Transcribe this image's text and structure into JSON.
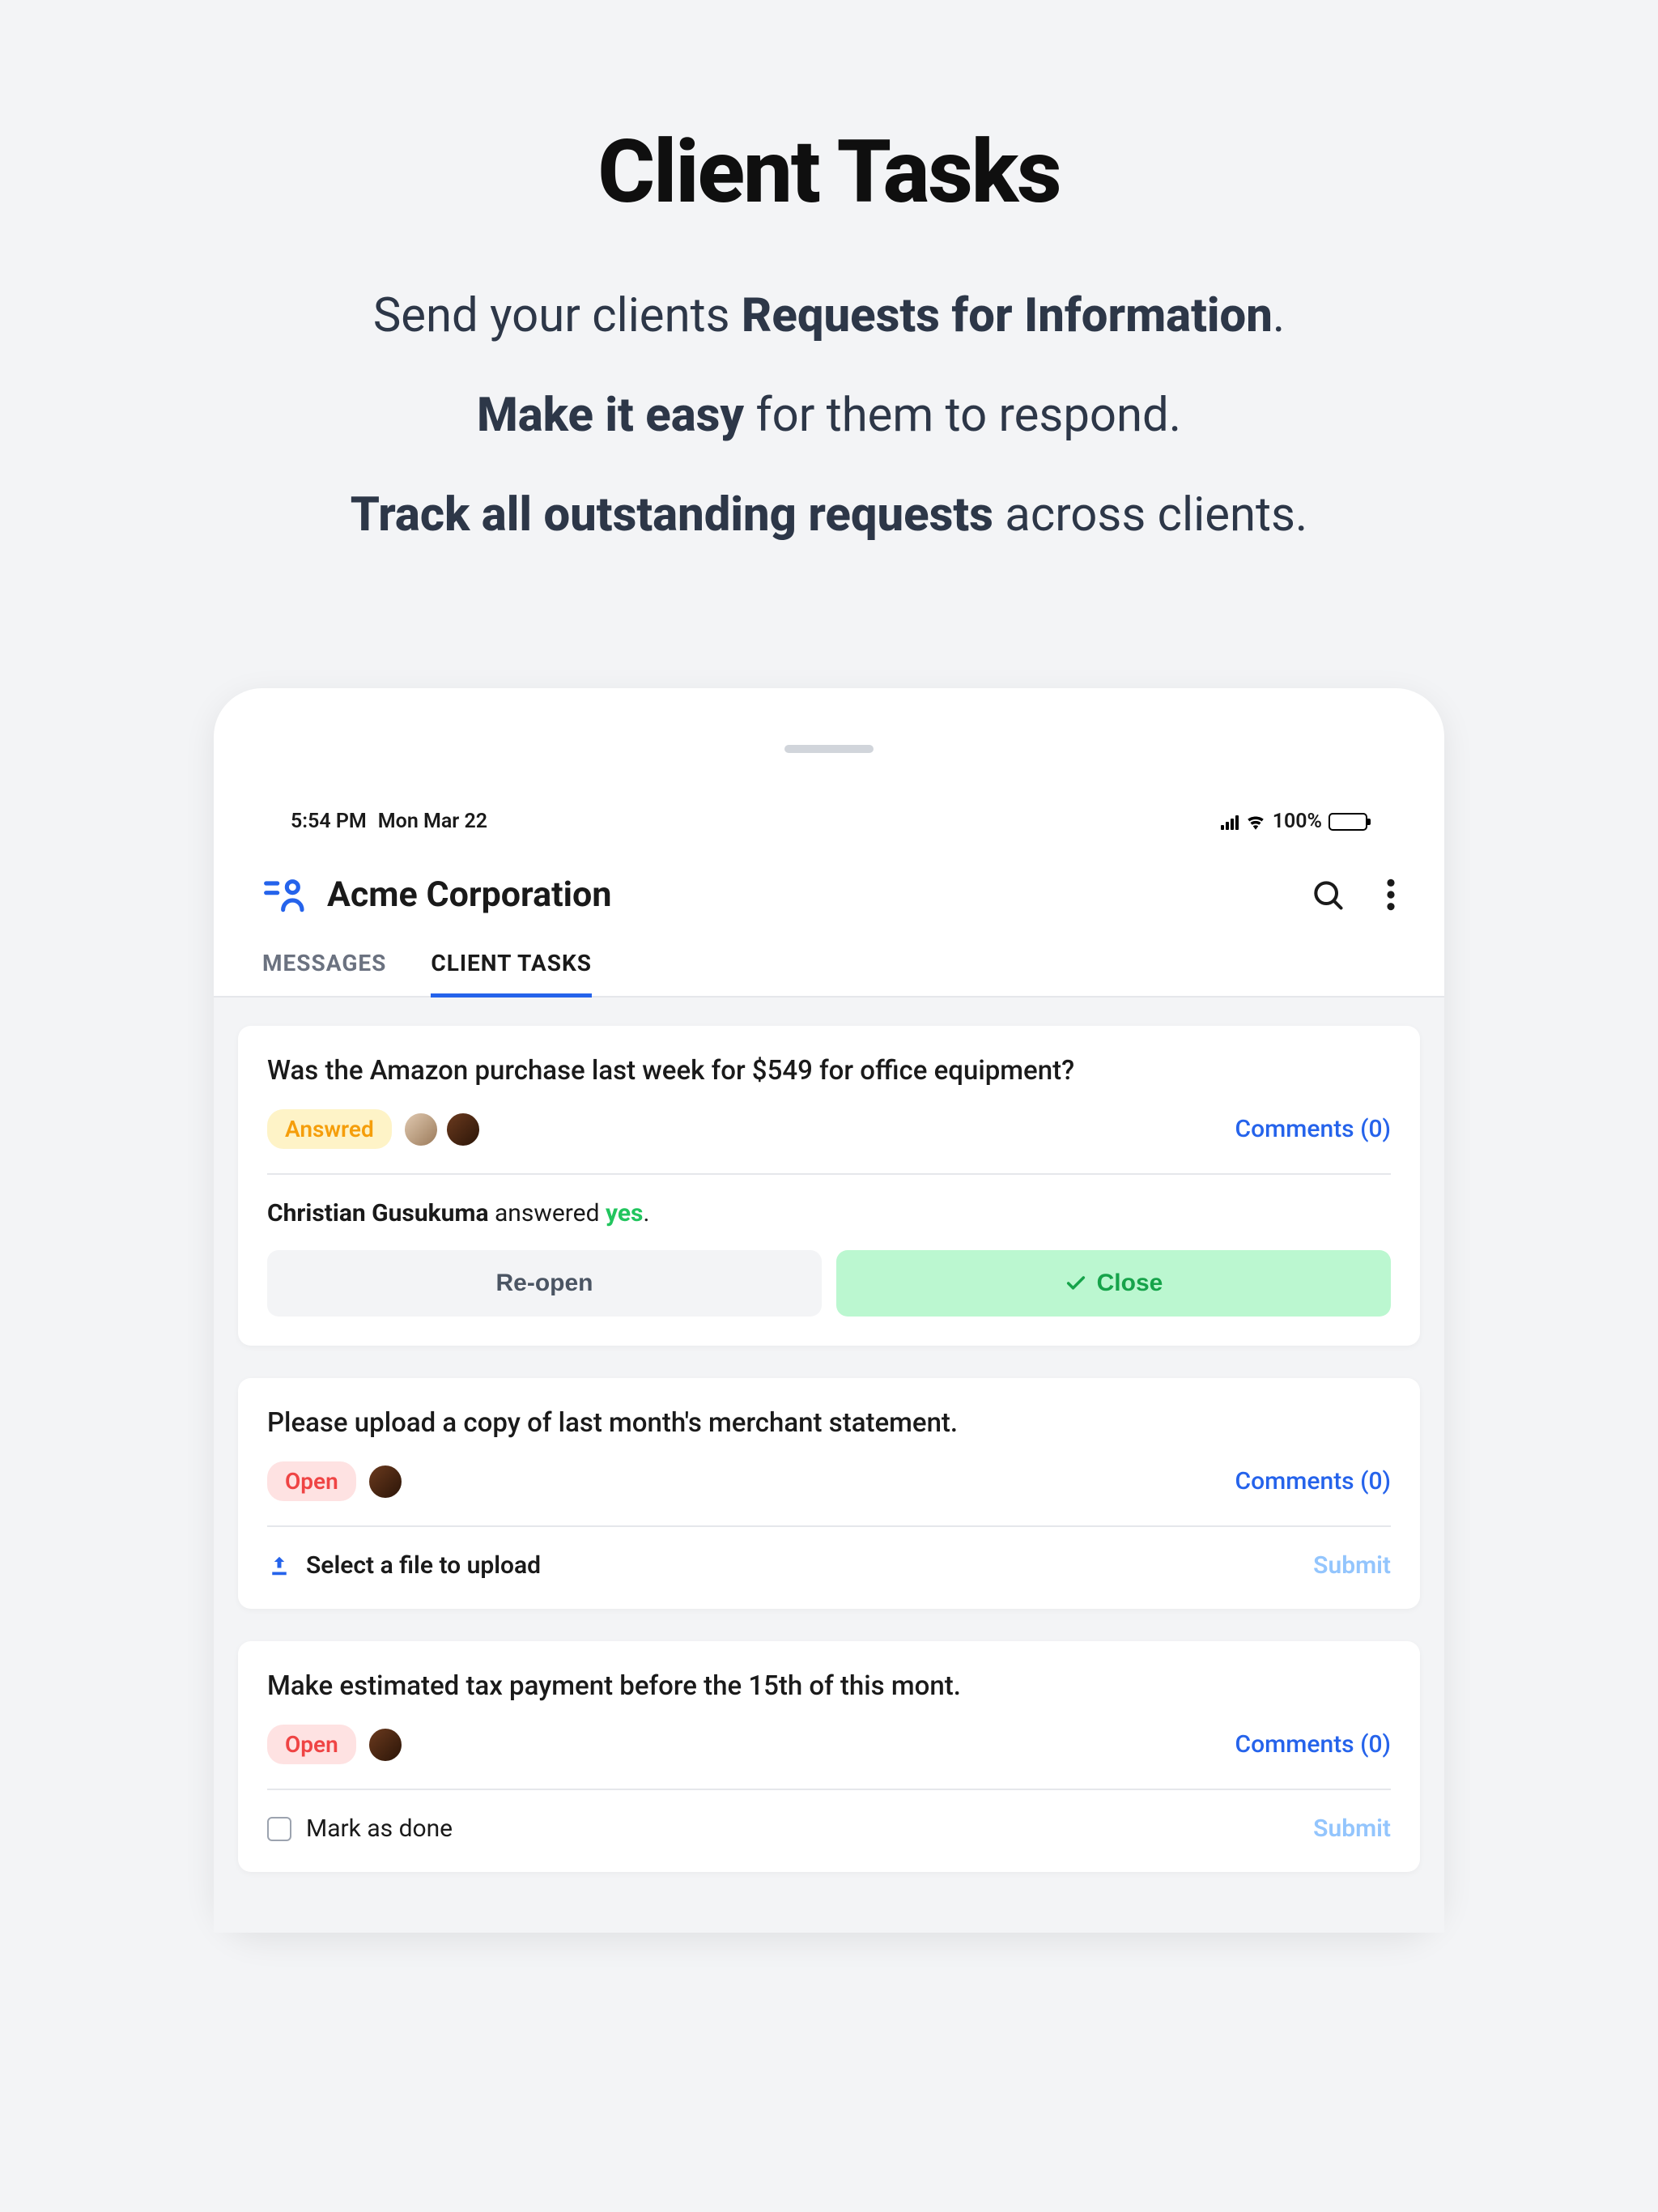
{
  "hero": {
    "title": "Client Tasks",
    "line1_pre": "Send your clients ",
    "line1_bold": "Requests for Information",
    "line1_post": ".",
    "line2_bold": "Make it easy",
    "line2_post": " for them to respond.",
    "line3_bold": "Track all outstanding requests",
    "line3_post": " across clients."
  },
  "statusbar": {
    "time": "5:54 PM",
    "date": "Mon Mar 22",
    "battery": "100%"
  },
  "header": {
    "company": "Acme Corporation"
  },
  "tabs": [
    {
      "label": "MESSAGES",
      "active": false
    },
    {
      "label": "CLIENT TASKS",
      "active": true
    }
  ],
  "tasks": [
    {
      "title": "Was the Amazon purchase last week for $549 for office equipment?",
      "status": {
        "text": "Answred",
        "kind": "answered"
      },
      "avatars": 2,
      "comments": "Comments (0)",
      "answer": {
        "name": "Christian Gusukuma",
        "verb": " answered ",
        "value": "yes",
        "tail": "."
      },
      "actions": {
        "reopen": "Re-open",
        "close": "Close"
      }
    },
    {
      "title": "Please upload a copy of last month's merchant statement.",
      "status": {
        "text": "Open",
        "kind": "open"
      },
      "avatars": 1,
      "comments": "Comments (0)",
      "upload": "Select a file to upload",
      "submit": "Submit"
    },
    {
      "title": "Make estimated tax payment before the 15th of this mont.",
      "status": {
        "text": "Open",
        "kind": "open"
      },
      "avatars": 1,
      "comments": "Comments (0)",
      "checkbox": "Mark as done",
      "submit": "Submit"
    }
  ]
}
